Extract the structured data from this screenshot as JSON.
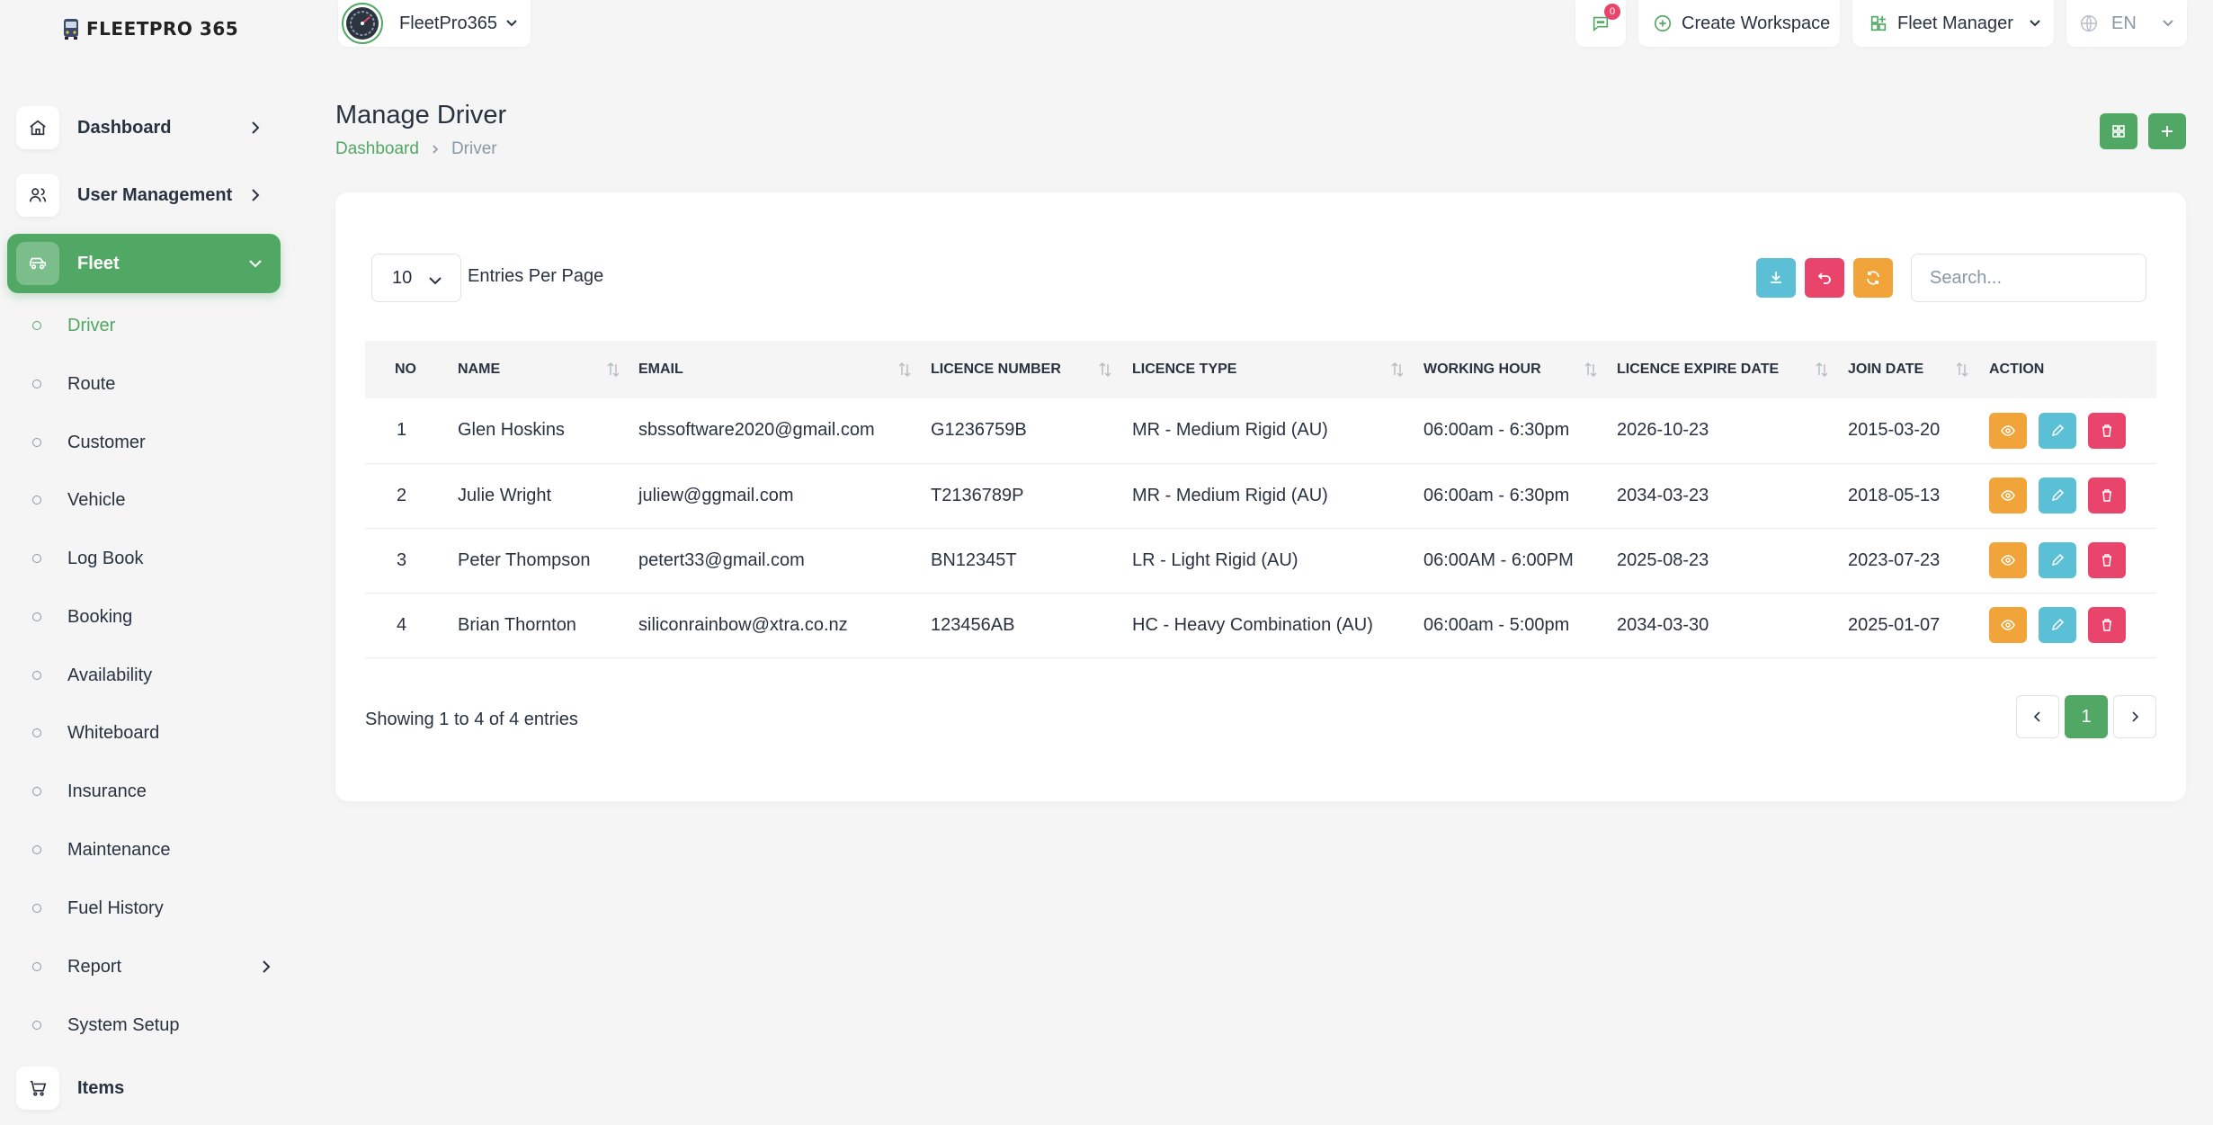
{
  "brand": {
    "logo_text": "FLEETPRO 365"
  },
  "sidebar": {
    "top_items": [
      {
        "label": "Dashboard",
        "icon": "home-icon"
      },
      {
        "label": "User Management",
        "icon": "users-icon"
      },
      {
        "label": "Fleet",
        "icon": "car-icon"
      }
    ],
    "sub_items": [
      {
        "label": "Driver"
      },
      {
        "label": "Route"
      },
      {
        "label": "Customer"
      },
      {
        "label": "Vehicle"
      },
      {
        "label": "Log Book"
      },
      {
        "label": "Booking"
      },
      {
        "label": "Availability"
      },
      {
        "label": "Whiteboard"
      },
      {
        "label": "Insurance"
      },
      {
        "label": "Maintenance"
      },
      {
        "label": "Fuel History"
      },
      {
        "label": "Report"
      },
      {
        "label": "System Setup"
      }
    ],
    "bottom_item": {
      "label": "Items",
      "icon": "cart-icon"
    }
  },
  "header": {
    "workspace_name": "FleetPro365",
    "message_count": "0",
    "create_workspace_label": "Create Workspace",
    "role_label": "Fleet Manager",
    "language": "EN"
  },
  "page": {
    "title": "Manage Driver",
    "breadcrumb": [
      "Dashboard",
      "Driver"
    ]
  },
  "table_controls": {
    "per_page_value": "10",
    "per_page_label": "Entries Per Page",
    "search_placeholder": "Search..."
  },
  "table": {
    "columns": [
      "NO",
      "NAME",
      "EMAIL",
      "LICENCE NUMBER",
      "LICENCE TYPE",
      "WORKING HOUR",
      "LICENCE EXPIRE DATE",
      "JOIN DATE",
      "ACTION"
    ],
    "rows": [
      [
        "1",
        "Glen Hoskins",
        "sbssoftware2020@gmail.com",
        "G1236759B",
        "MR - Medium Rigid (AU)",
        "06:00am - 6:30pm",
        "2026-10-23",
        "2015-03-20"
      ],
      [
        "2",
        "Julie Wright",
        "juliew@ggmail.com",
        "T2136789P",
        "MR - Medium Rigid (AU)",
        "06:00am - 6:30pm",
        "2034-03-23",
        "2018-05-13"
      ],
      [
        "3",
        "Peter Thompson",
        "petert33@gmail.com",
        "BN12345T",
        "LR - Light Rigid (AU)",
        "06:00AM - 6:00PM",
        "2025-08-23",
        "2023-07-23"
      ],
      [
        "4",
        "Brian Thornton",
        "siliconrainbow@xtra.co.nz",
        "123456AB",
        "HC - Heavy Combination (AU)",
        "06:00am - 5:00pm",
        "2034-03-30",
        "2025-01-07"
      ]
    ]
  },
  "footer": {
    "showing_text": "Showing 1 to 4 of 4 entries",
    "current_page": "1"
  },
  "colors": {
    "primary": "#51a864",
    "info": "#5bc0d5",
    "danger": "#e8446c",
    "warning": "#f0a43a"
  }
}
